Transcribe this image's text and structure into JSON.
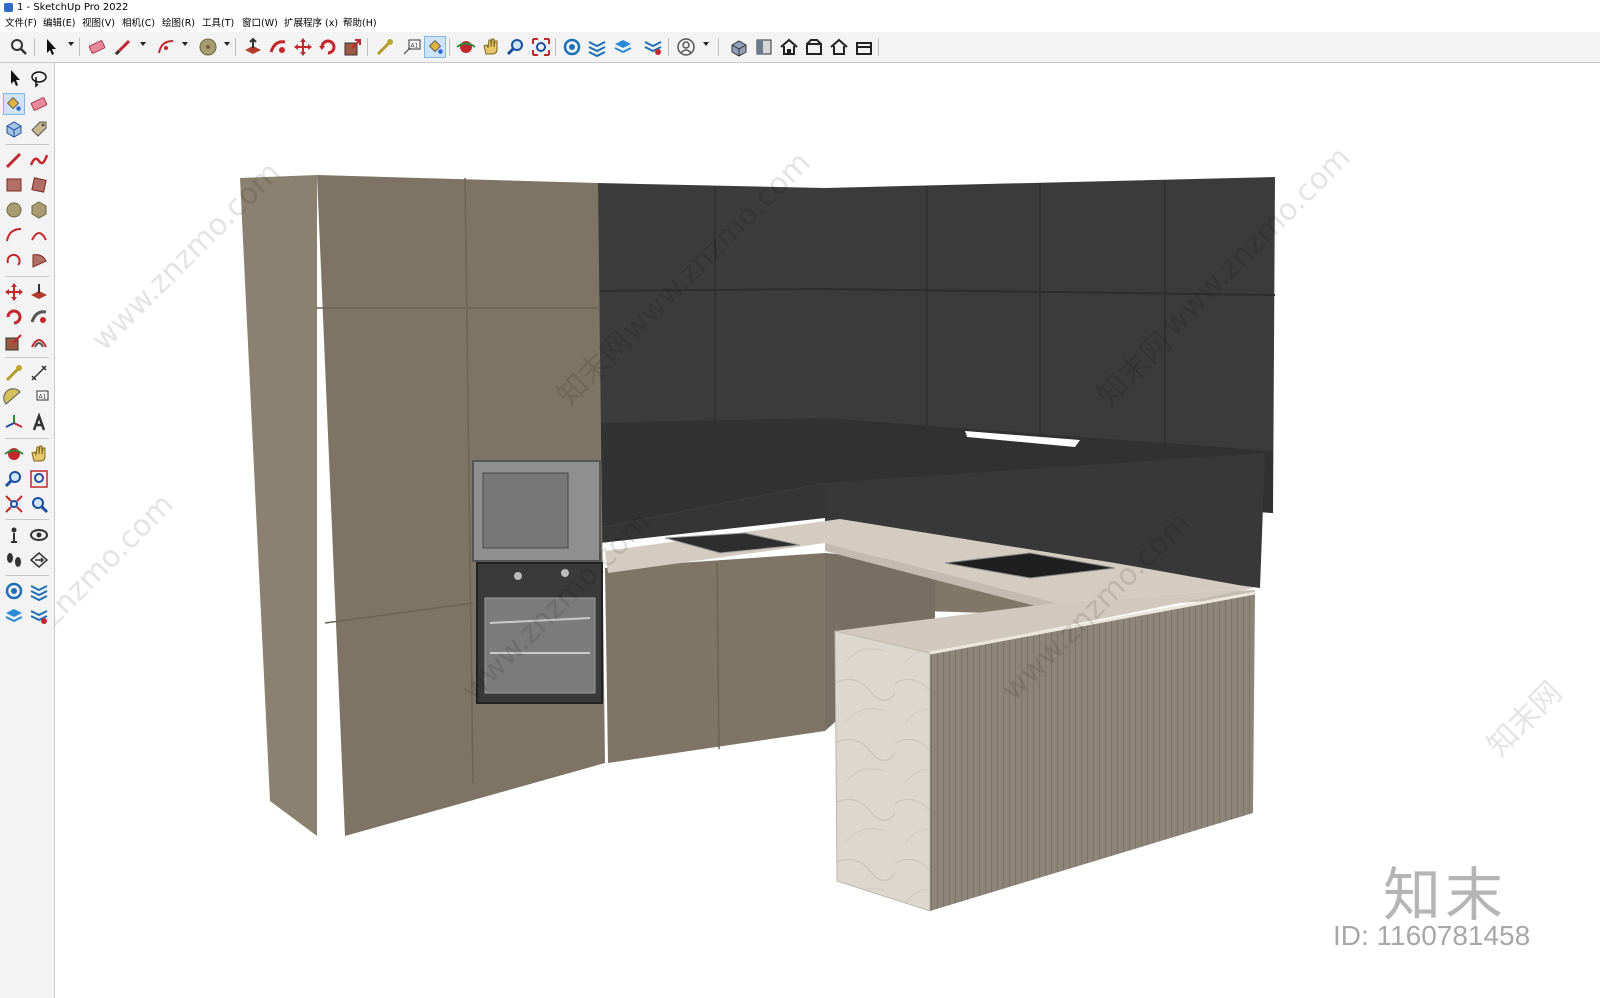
{
  "window": {
    "title": "1 - SketchUp Pro 2022"
  },
  "menu": [
    "文件(F)",
    "编辑(E)",
    "视图(V)",
    "相机(C)",
    "绘图(R)",
    "工具(T)",
    "窗口(W)",
    "扩展程序 (x)",
    "帮助(H)"
  ],
  "watermark": {
    "site": "www.znzmo.com",
    "site_alt": "znzmo.com",
    "brand_small": "知末网",
    "brand_large": "知末",
    "id": "ID: 1160781458"
  },
  "colors": {
    "cabinet_beige": "#7e7567",
    "upper_dark": "#3a3a3a",
    "countertop": "#d4cbc0",
    "marble": "#ddd8d0",
    "slatted": "#8a8175",
    "toolbar_bg": "#f3f3f3",
    "active_tool": "#cde4f7"
  }
}
